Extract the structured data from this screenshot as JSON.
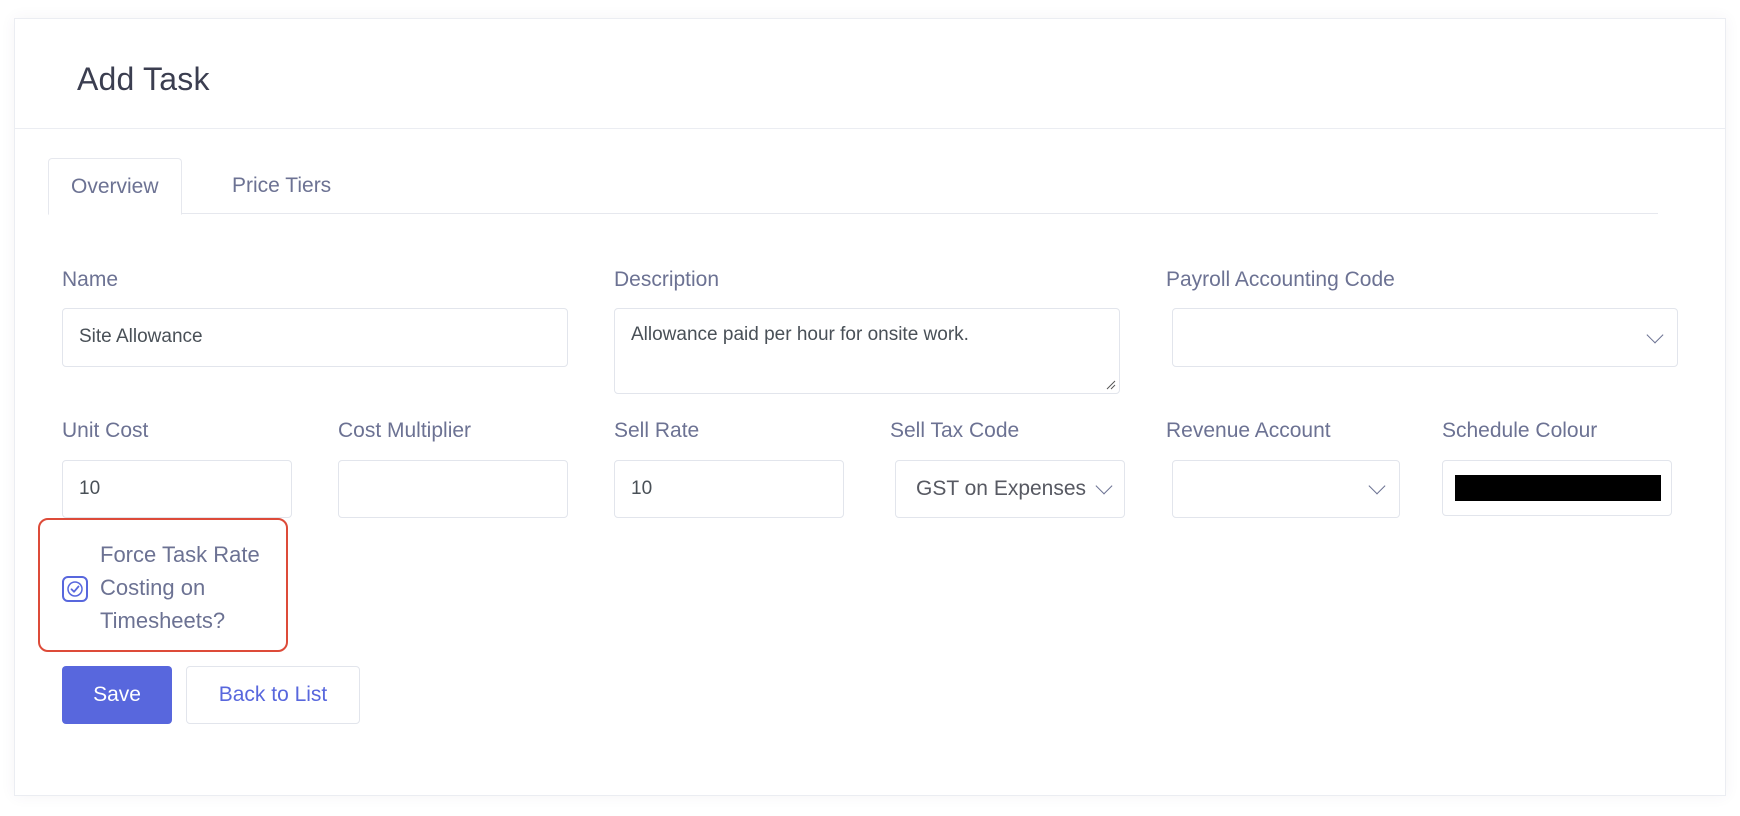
{
  "header": {
    "title": "Add Task"
  },
  "tabs": [
    {
      "label": "Overview",
      "active": true
    },
    {
      "label": "Price Tiers",
      "active": false
    }
  ],
  "form": {
    "name": {
      "label": "Name",
      "value": "Site Allowance"
    },
    "description": {
      "label": "Description",
      "value": "Allowance paid per hour for onsite work."
    },
    "payroll_code": {
      "label": "Payroll Accounting Code",
      "value": ""
    },
    "unit_cost": {
      "label": "Unit Cost",
      "value": "10"
    },
    "cost_multiplier": {
      "label": "Cost Multiplier",
      "value": ""
    },
    "sell_rate": {
      "label": "Sell Rate",
      "value": "10"
    },
    "sell_tax_code": {
      "label": "Sell Tax Code",
      "value": "GST on Expenses"
    },
    "revenue_account": {
      "label": "Revenue Account",
      "value": ""
    },
    "schedule_colour": {
      "label": "Schedule Colour",
      "value": "#000000"
    },
    "force_task_rate": {
      "label": "Force Task Rate Costing on Timesheets?",
      "checked": true
    }
  },
  "actions": {
    "save": "Save",
    "back": "Back to List"
  },
  "colors": {
    "accent": "#5867dd",
    "highlight": "#dd4b39"
  }
}
